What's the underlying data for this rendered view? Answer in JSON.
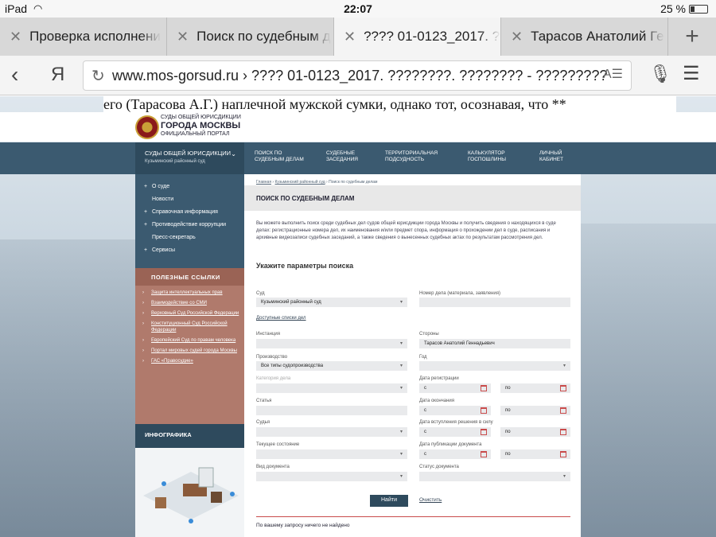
{
  "status": {
    "device": "iPad",
    "time": "22:07",
    "battery": "25 %"
  },
  "tabs": [
    {
      "label": "Проверка исполнени"
    },
    {
      "label": "Поиск по судебным д"
    },
    {
      "label": "???? 01-0123_2017. ??"
    },
    {
      "label": "Тарасов Анатолий Ге"
    }
  ],
  "urlbar": {
    "browser": "Я",
    "url": "www.mos-gorsud.ru › ???? 01-0123_2017. ????????. ???????? - ?????????"
  },
  "overlay_text": "его (Тарасова А.Г.) наплечной мужской сумки, однако тот, осознавая, что **",
  "header": {
    "logo_line1": "СУДЫ ОБЩЕЙ ЮРИСДИКЦИИ",
    "logo_line2": "ГОРОДА МОСКВЫ",
    "logo_line3": "ОФИЦИАЛЬНЫЙ ПОРТАЛ"
  },
  "nav": {
    "court_label": "Суды общей юрисдикции",
    "court_name": "Кузьминский районный суд",
    "items": [
      {
        "line1": "Поиск по",
        "line2": "судебным делам"
      },
      {
        "line1": "Судебные",
        "line2": "заседания"
      },
      {
        "line1": "Территориальная",
        "line2": "подсудность"
      },
      {
        "line1": "Калькулятор",
        "line2": "госпошлины"
      },
      {
        "line1": "Личный",
        "line2": "кабинет"
      }
    ]
  },
  "sidebar": {
    "items": [
      {
        "prefix": "+",
        "label": "О суде"
      },
      {
        "prefix": "",
        "label": "Новости"
      },
      {
        "prefix": "+",
        "label": "Справочная информация"
      },
      {
        "prefix": "+",
        "label": "Противодействие коррупции"
      },
      {
        "prefix": "",
        "label": "Пресс-секретарь"
      },
      {
        "prefix": "+",
        "label": "Сервисы"
      }
    ],
    "useful_title": "Полезные ссылки",
    "useful_links": [
      "Защита интеллектуальных прав",
      "Взаимодействие со СМИ",
      "Верховный Суд Российской Федерации",
      "Конституционный Суд Российской Федерации",
      "Европейский Суд по правам человека",
      "Портал мировых судей города Москвы",
      "ГАС «Правосудие»"
    ],
    "infographics_title": "Инфографика"
  },
  "main": {
    "breadcrumb": [
      "Главная",
      "Кузьминский районный суд",
      "Поиск по судебным делам"
    ],
    "title": "Поиск по судебным делам",
    "intro": "Вы можете выполнить поиск среди судебных дел судов общей юрисдикции города Москвы и получить сведения о находящихся в суде делах: регистрационные номера дел, их наименования и/или предмет спора, информация о прохождении дел в суде, расписания и архивные видеозаписи судебных заседаний, а также сведения о вынесенных судебных актах по результатам рассмотрения дел.",
    "form_title": "Укажите параметры поиска",
    "fields": {
      "court_label": "Суд",
      "court_value": "Кузьминский районный суд",
      "case_no_label": "Номер дела (материала, заявления)",
      "available_lists": "Доступные списки дел",
      "instance_label": "Инстанция",
      "parties_label": "Стороны",
      "parties_value": "Тарасов Анатолий Геннадьевич",
      "proceeding_label": "Производство",
      "proceeding_value": "Все типы судопроизводства",
      "year_label": "Год",
      "category_label": "Категория дела",
      "reg_date_label": "Дата регистрации",
      "article_label": "Статья",
      "end_date_label": "Дата окончания",
      "judge_label": "Судья",
      "effective_date_label": "Дата вступления решения в силу",
      "state_label": "Текущее состояние",
      "pub_date_label": "Дата публикации документа",
      "doc_type_label": "Вид документа",
      "doc_status_label": "Статус документа",
      "from": "с",
      "to": "по"
    },
    "search_button": "Найти",
    "clear_link": "Очистить",
    "result": "По вашему запросу ничего не найдено"
  }
}
